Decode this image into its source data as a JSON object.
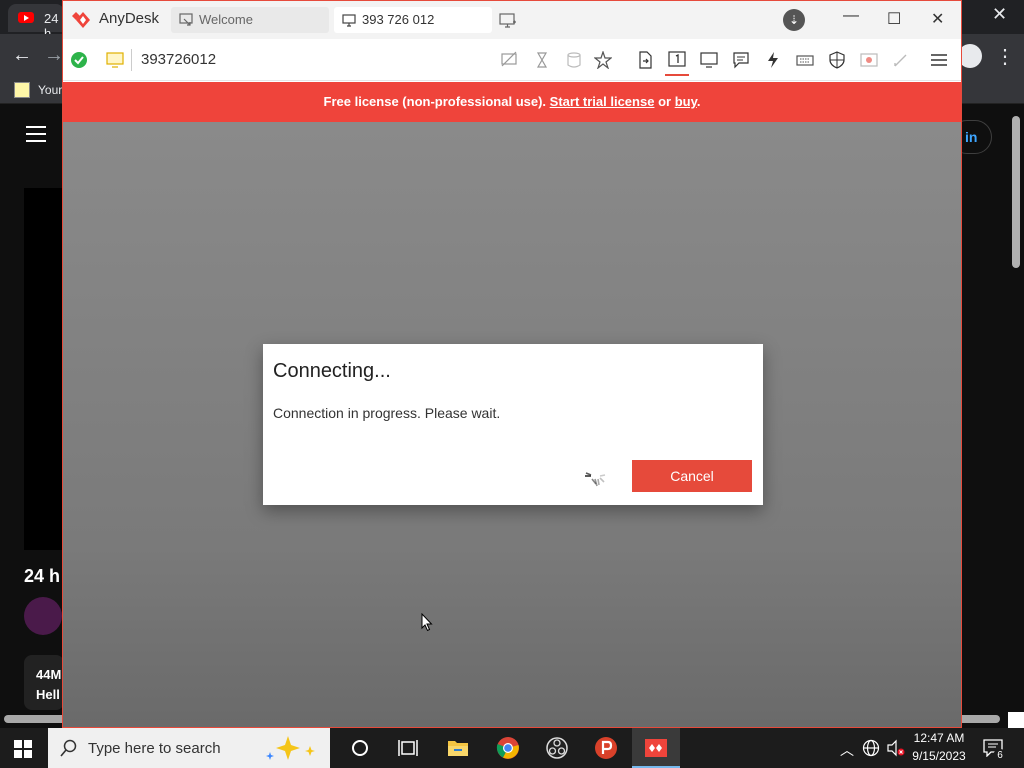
{
  "background_browser": {
    "tab_title": "24 h",
    "bookmark_label": "Your",
    "sign_in_label": "in",
    "video_heading": "24 h",
    "meta_line1": "44M",
    "meta_line2": "Hell"
  },
  "anydesk": {
    "app_name": "AnyDesk",
    "tabs": [
      {
        "label": "Welcome",
        "icon": "arrow-in-icon"
      },
      {
        "label": "393 726 012",
        "icon": "monitor-icon"
      }
    ],
    "address": "393726012",
    "banner": {
      "prefix": "Free license (non-professional use).",
      "trial_link": "Start trial license",
      "or": "or",
      "buy_link": "buy",
      "suffix": "."
    },
    "dialog": {
      "title": "Connecting...",
      "message": "Connection in progress. Please wait.",
      "cancel_label": "Cancel"
    },
    "colors": {
      "brand": "#ef443b",
      "status_ok": "#2db34a"
    }
  },
  "taskbar": {
    "search_placeholder": "Type here to search",
    "time": "12:47 AM",
    "date": "9/15/2023",
    "notification_count": "6"
  }
}
